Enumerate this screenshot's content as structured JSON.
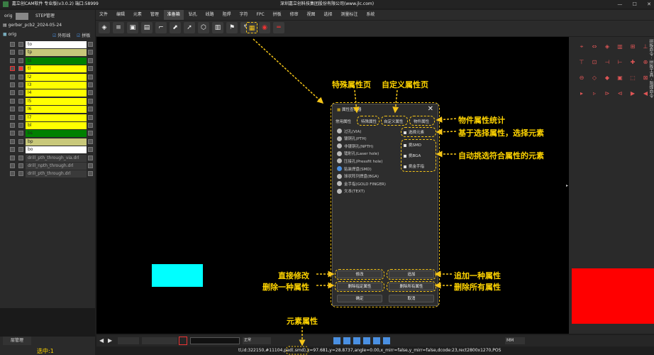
{
  "window": {
    "app_title": "嘉立创CAM软件 专业版(v3.0.2) 端口:58999",
    "company": "深圳嘉立创科技集团股份有限公司(www.jlc.com)",
    "minimize": "—",
    "maximize": "☐",
    "close": "✕"
  },
  "menu": [
    "文件",
    "编辑",
    "元素",
    "管理",
    "准备箱",
    "钻孔",
    "线路",
    "阻焊",
    "字符",
    "FPC",
    "拼板",
    "修审",
    "视图",
    "选择",
    "测量标注",
    "系统"
  ],
  "left_panel": {
    "tabs": [
      "orig",
      "STEP管理"
    ],
    "job_name": "gerber_pcb2_2024-05-24",
    "step": "orig",
    "checks": [
      "外形线",
      "拼板"
    ],
    "layers": [
      {
        "name": "to",
        "color": "#ffffff"
      },
      {
        "name": "tp",
        "color": "#c8c87a"
      },
      {
        "name": "ts",
        "color": "#008000"
      },
      {
        "name": "tl",
        "color": "#ffff00"
      },
      {
        "name": "l2",
        "color": "#ffff00"
      },
      {
        "name": "l3",
        "color": "#ffff00"
      },
      {
        "name": "l4",
        "color": "#ffff00"
      },
      {
        "name": "l5",
        "color": "#ffff00"
      },
      {
        "name": "l6",
        "color": "#ffff00"
      },
      {
        "name": "l7",
        "color": "#ffff00"
      },
      {
        "name": "bl",
        "color": "#ffff00"
      },
      {
        "name": "bs",
        "color": "#008000"
      },
      {
        "name": "bp",
        "color": "#c8c87a"
      },
      {
        "name": "bo",
        "color": "#ffffff"
      },
      {
        "name": "drill_pth_through_via.drl",
        "color": "#3a3a3a"
      },
      {
        "name": "drill_npth_through.drl",
        "color": "#3a3a3a"
      },
      {
        "name": "drill_pth_through.drl",
        "color": "#3a3a3a"
      }
    ],
    "layer_manager": "层管理",
    "selected_count": "选中:1"
  },
  "dialog": {
    "title": "属性查询器",
    "tabs": [
      "常用属性",
      "特殊属性",
      "自定义属性",
      "物件属性"
    ],
    "options": [
      {
        "label": "过孔(VIA)",
        "on": false
      },
      {
        "label": "镀铜孔(PTH)",
        "on": false
      },
      {
        "label": "非镀铜孔(NPTH)",
        "on": false
      },
      {
        "label": "镭射孔(Laser hole)",
        "on": false
      },
      {
        "label": "压接孔(Pressfit hole)",
        "on": false
      },
      {
        "label": "贴装焊盘(SMD)",
        "on": true
      },
      {
        "label": "球状阵列焊盘(BGA)",
        "on": false
      },
      {
        "label": "金手指(GOLD FINGER)",
        "on": false
      },
      {
        "label": "文本(TEXT)",
        "on": false
      }
    ],
    "select_elem": "选择元素",
    "pick_smd": "挑SMD",
    "pick_bga": "挑BGA",
    "pick_finger": "挑金手指",
    "modify": "修改",
    "add": "追加",
    "delete_one": "删除指定属性",
    "delete_all": "删除所有属性",
    "ok": "确定",
    "cancel": "取消"
  },
  "annotations": {
    "special": "特殊属性页",
    "custom": "自定义属性页",
    "object": "物件属性统计",
    "select_by": "基于选择属性，选择元素",
    "auto_pick": "自动挑选符合属性的元素",
    "modify": "直接修改",
    "delete_one": "删除一种属性",
    "add": "追加一种属性",
    "delete_all": "删除所有属性",
    "elem_attr": "元素属性"
  },
  "bottom": {
    "units": "MM",
    "mode": "正常",
    "status": "tl,id:322150,#11104,pad(.smd),x=97.681,y=28.8737,angle=0.00,x_mirr=false,y_mirr=false,dcode:23,rect2800x1270,POS"
  },
  "colors": {
    "accent": "#ffd400",
    "cyan": "#00ffff",
    "red": "#ff0000"
  }
}
